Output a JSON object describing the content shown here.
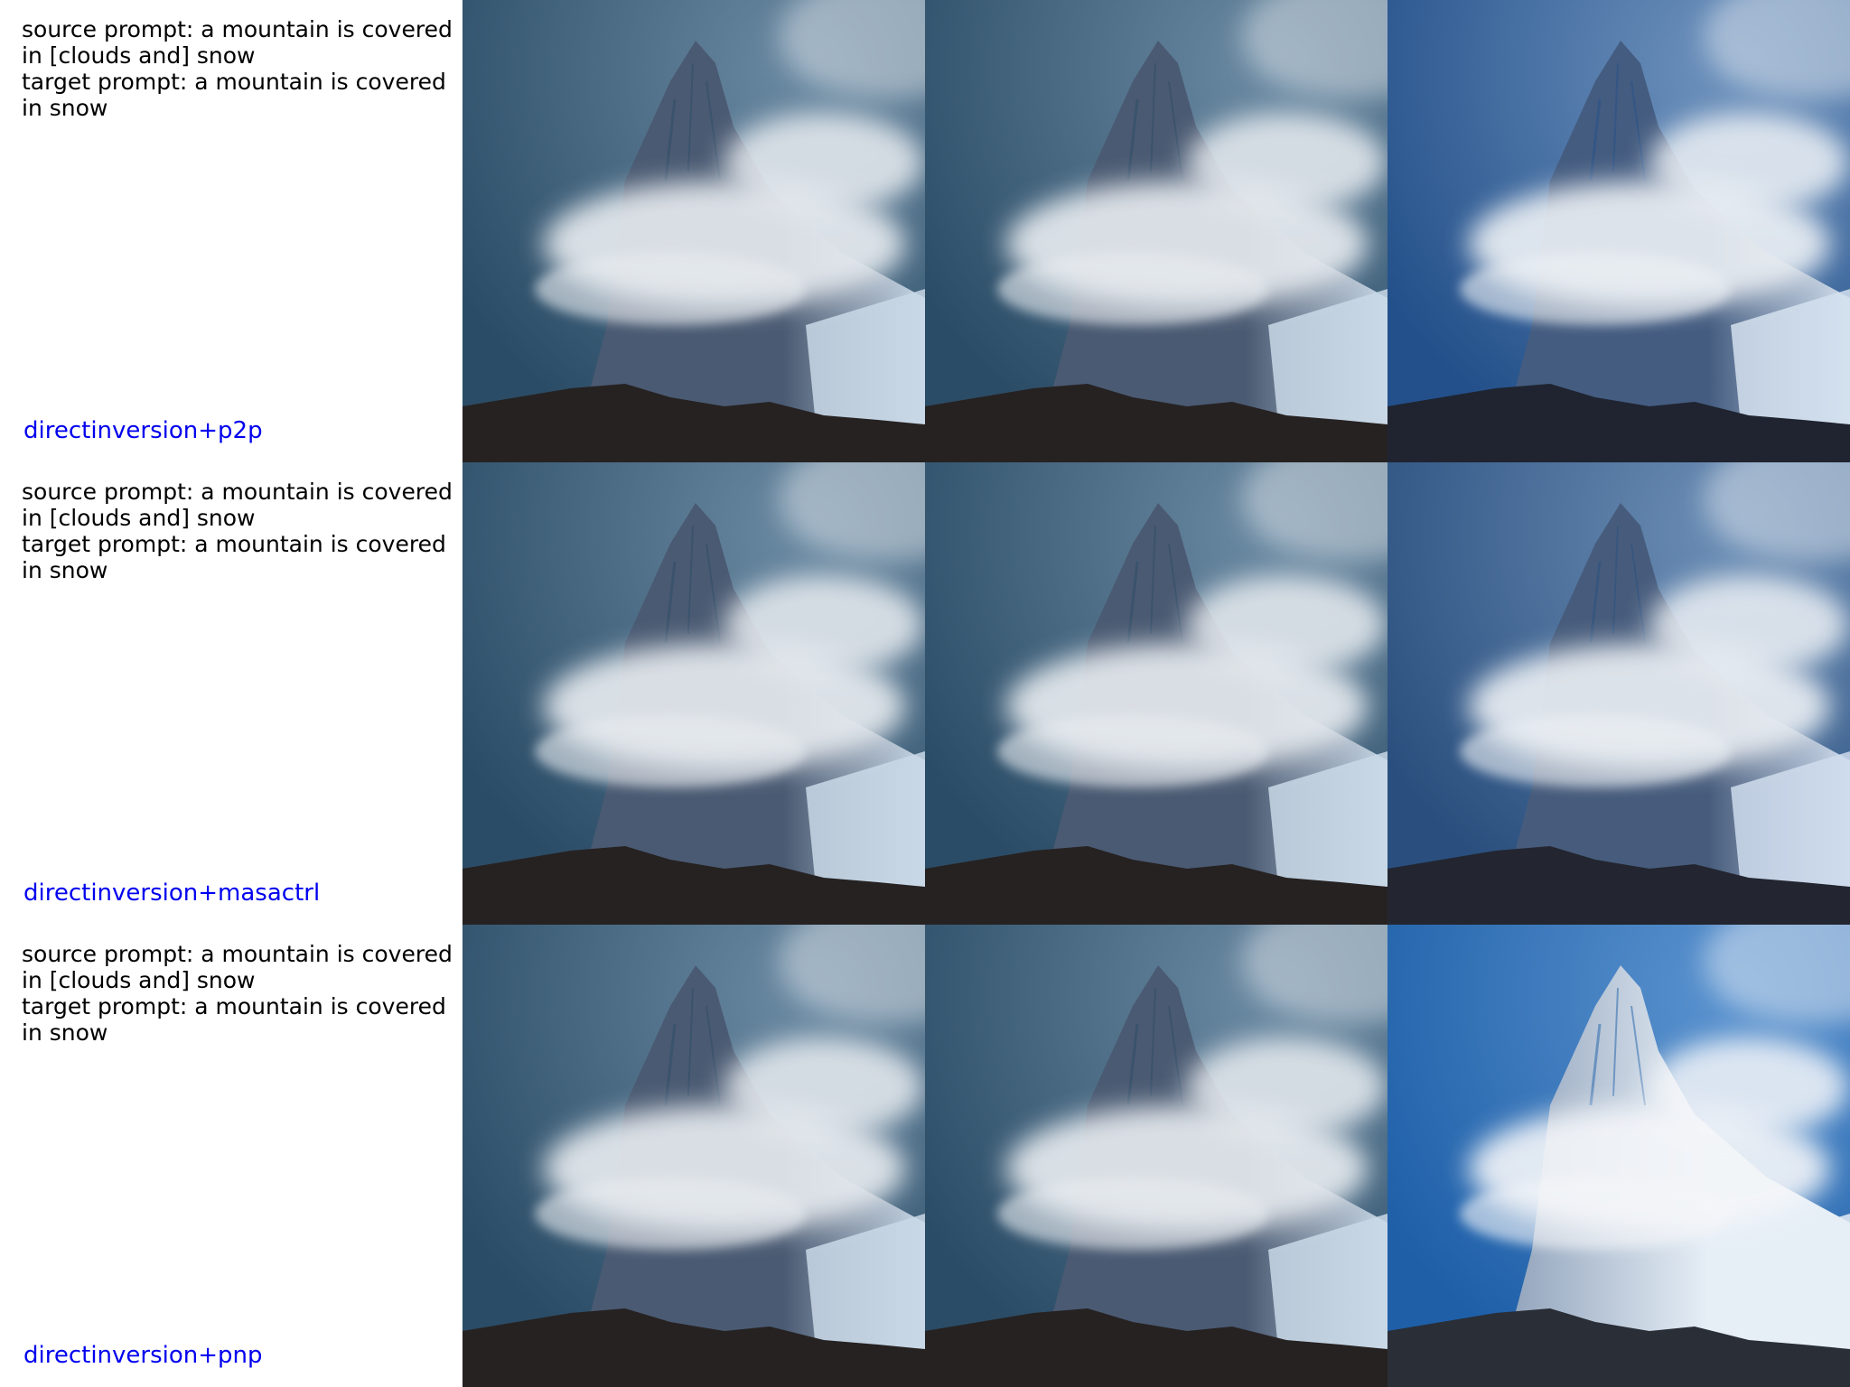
{
  "rows": [
    {
      "prompt_text": "source prompt: a mountain is covered\nin [clouds and] snow\ntarget prompt: a mountain is covered\nin snow",
      "method": "directinversion+p2p",
      "images": [
        {
          "name": "source",
          "sky": "#2b4c66",
          "sky_light": "#6b8aa3",
          "peak": "#4a5a72",
          "snow": "#c9d8e6",
          "cloud": "#e9edf1",
          "ground": "#262222",
          "has_snow_peak": false
        },
        {
          "name": "reconstruction",
          "sky": "#2b4c66",
          "sky_light": "#6b8aa3",
          "peak": "#4a5a72",
          "snow": "#c9d8e6",
          "cloud": "#e9edf1",
          "ground": "#262222",
          "has_snow_peak": false
        },
        {
          "name": "edited",
          "sky": "#23508a",
          "sky_light": "#6f93bd",
          "peak": "#445c80",
          "snow": "#d3e0ee",
          "cloud": "#eef2f6",
          "ground": "#1f2430",
          "has_snow_peak": false
        }
      ]
    },
    {
      "prompt_text": "source prompt: a mountain is covered\nin [clouds and] snow\ntarget prompt: a mountain is covered\nin snow",
      "method": "directinversion+masactrl",
      "images": [
        {
          "name": "source",
          "sky": "#2b4c66",
          "sky_light": "#6b8aa3",
          "peak": "#4a5a72",
          "snow": "#c9d8e6",
          "cloud": "#e9edf1",
          "ground": "#262222",
          "has_snow_peak": false
        },
        {
          "name": "reconstruction",
          "sky": "#2b4c66",
          "sky_light": "#6b8aa3",
          "peak": "#4a5a72",
          "snow": "#c9d8e6",
          "cloud": "#e9edf1",
          "ground": "#262222",
          "has_snow_peak": false
        },
        {
          "name": "edited",
          "sky": "#2a4f7e",
          "sky_light": "#6d8fb6",
          "peak": "#475c7c",
          "snow": "#cfdced",
          "cloud": "#edf1f5",
          "ground": "#232630",
          "has_snow_peak": false
        }
      ]
    },
    {
      "prompt_text": "source prompt: a mountain is covered\nin [clouds and] snow\ntarget prompt: a mountain is covered\nin snow",
      "method": "directinversion+pnp",
      "images": [
        {
          "name": "source",
          "sky": "#2b4c66",
          "sky_light": "#6b8aa3",
          "peak": "#4a5a72",
          "snow": "#c9d8e6",
          "cloud": "#e9edf1",
          "ground": "#262222",
          "has_snow_peak": false
        },
        {
          "name": "reconstruction",
          "sky": "#2b4c66",
          "sky_light": "#6b8aa3",
          "peak": "#4a5a72",
          "snow": "#c9d8e6",
          "cloud": "#e9edf1",
          "ground": "#262222",
          "has_snow_peak": false
        },
        {
          "name": "edited",
          "sky": "#1e5fa8",
          "sky_light": "#5b93cf",
          "peak": "#8c9fb8",
          "snow": "#e6eef6",
          "cloud": "#f4f6f9",
          "ground": "#2a2e36",
          "has_snow_peak": true
        }
      ]
    }
  ]
}
